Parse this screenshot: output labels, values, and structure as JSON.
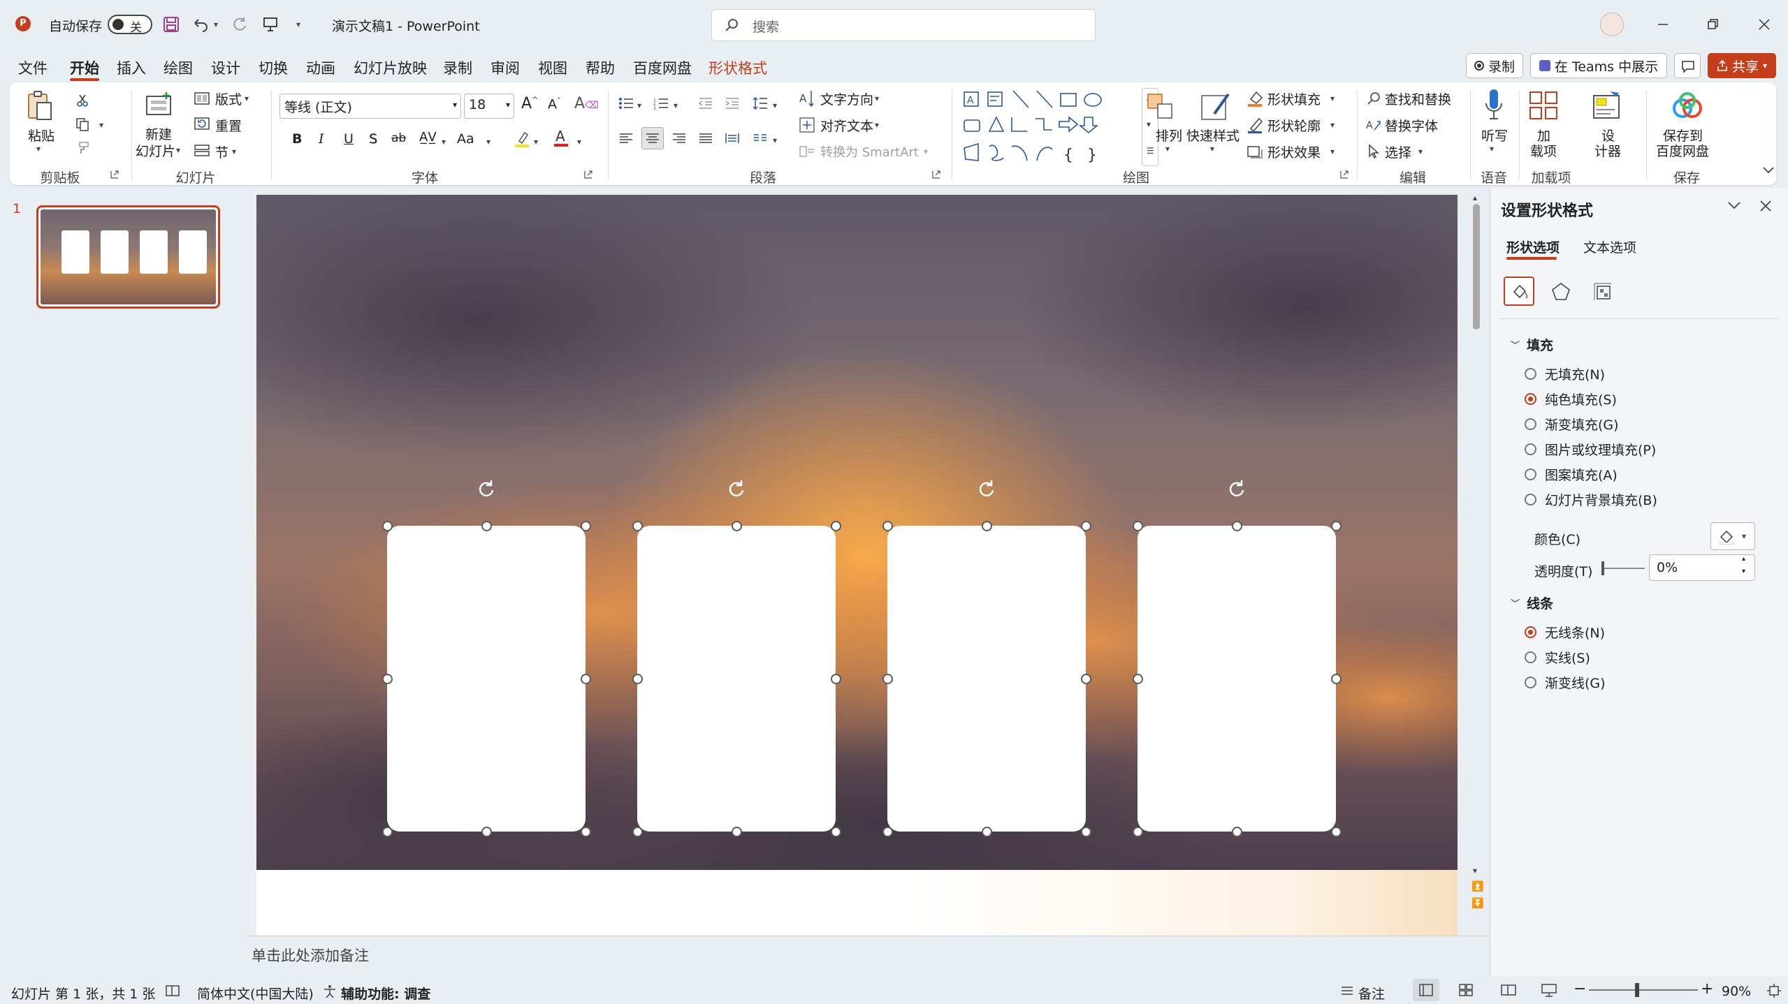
{
  "titlebar": {
    "autosave_label": "自动保存",
    "autosave_state": "关",
    "doc_title": "演示文稿1  -  PowerPoint",
    "search_placeholder": "搜索"
  },
  "tabs": [
    "文件",
    "开始",
    "插入",
    "绘图",
    "设计",
    "切换",
    "动画",
    "幻灯片放映",
    "录制",
    "审阅",
    "视图",
    "帮助",
    "百度网盘",
    "形状格式"
  ],
  "tab_right": {
    "record": "录制",
    "teams": "在 Teams 中展示",
    "share": "共享"
  },
  "ribbon": {
    "clipboard": {
      "paste": "粘贴",
      "group": "剪贴板"
    },
    "slides": {
      "new_slide_1": "新建",
      "new_slide_2": "幻灯片",
      "layout": "版式",
      "reset": "重置",
      "section": "节",
      "group": "幻灯片"
    },
    "font": {
      "font_name": "等线 (正文)",
      "font_size": "18",
      "bold": "B",
      "italic": "I",
      "underline": "U",
      "shadow": "S",
      "strike": "ab",
      "case": "Aa",
      "group": "字体"
    },
    "paragraph": {
      "text_direction": "文字方向",
      "align_text": "对齐文本",
      "smartart": "转换为 SmartArt",
      "group": "段落"
    },
    "drawing": {
      "arrange": "排列",
      "quick_styles": "快速样式",
      "shape_fill": "形状填充",
      "shape_outline": "形状轮廓",
      "shape_effects": "形状效果",
      "group": "绘图"
    },
    "editing": {
      "find_replace": "查找和替换",
      "replace_font": "替换字体",
      "select": "选择",
      "group": "编辑"
    },
    "voice": {
      "dictate": "听写",
      "group": "语音"
    },
    "addins": {
      "label_1": "加",
      "label_2": "载项",
      "group": "加载项"
    },
    "designer": {
      "label_1": "设",
      "label_2": "计器"
    },
    "save": {
      "label_1": "保存到",
      "label_2": "百度网盘",
      "group": "保存"
    }
  },
  "thumbnail": {
    "number": "1"
  },
  "notes": {
    "placeholder": "单击此处添加备注"
  },
  "panel": {
    "title": "设置形状格式",
    "tab_shape": "形状选项",
    "tab_text": "文本选项",
    "fill_header": "填充",
    "fill_options": [
      "无填充(N)",
      "纯色填充(S)",
      "渐变填充(G)",
      "图片或纹理填充(P)",
      "图案填充(A)",
      "幻灯片背景填充(B)"
    ],
    "fill_selected": 1,
    "color_label": "颜色(C)",
    "transparency_label": "透明度(T)",
    "transparency_value": "0%",
    "line_header": "线条",
    "line_options": [
      "无线条(N)",
      "实线(S)",
      "渐变线(G)"
    ],
    "line_selected": 0
  },
  "status": {
    "slide_info": "幻灯片 第 1 张，共 1 张",
    "language": "简体中文(中国大陆)",
    "accessibility": "辅助功能: 调查",
    "notes": "备注",
    "zoom": "90%"
  },
  "colors": {
    "accent": "#c43e1c",
    "ribbon_bg": "#ffffff",
    "chrome_bg": "#e9eef3"
  }
}
